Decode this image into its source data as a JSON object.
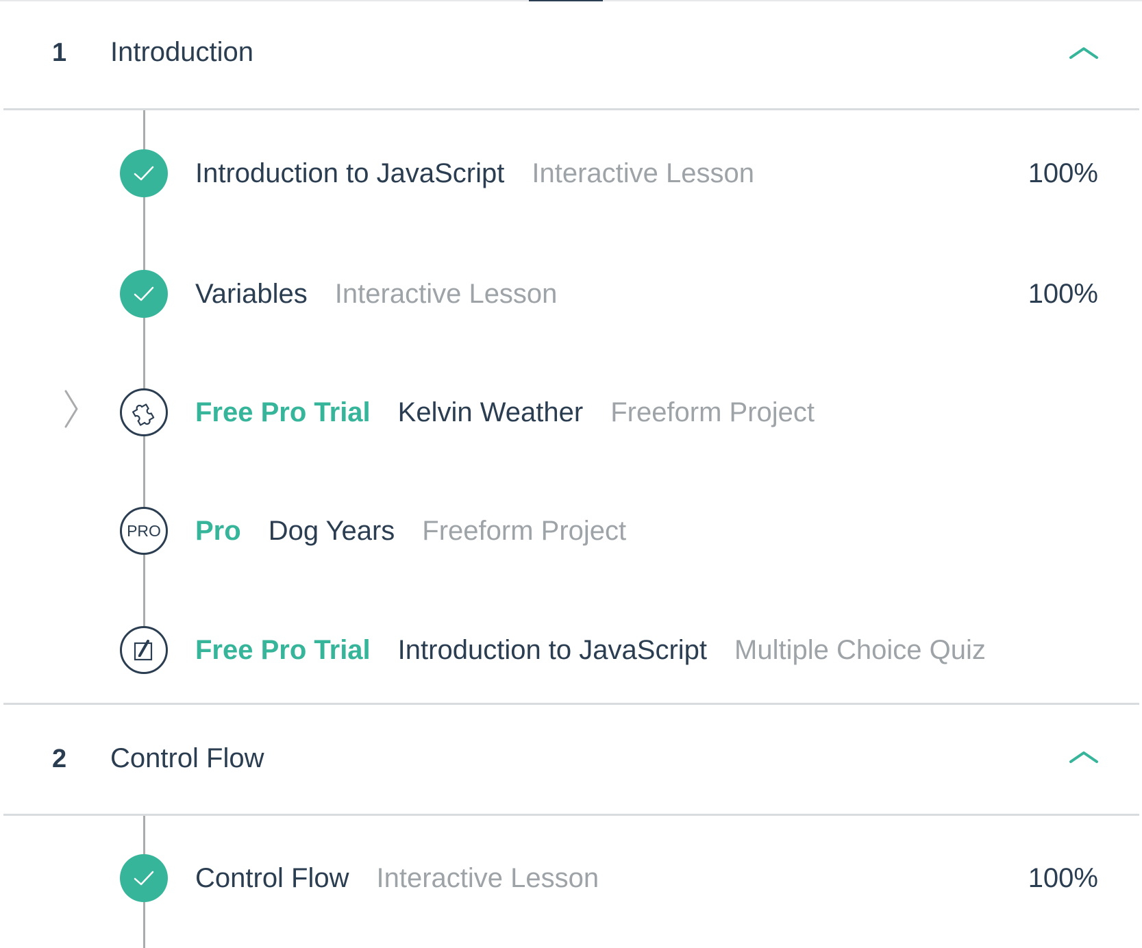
{
  "colors": {
    "accent": "#36b59b",
    "text_dark": "#2b3d50",
    "text_muted": "#9ea3a8",
    "rule": "#d9dcde",
    "timeline": "#a9abad"
  },
  "sections": [
    {
      "number": "1",
      "title": "Introduction",
      "expanded": true,
      "items": [
        {
          "status": "complete",
          "icon": "check-icon",
          "badge": "",
          "title": "Introduction to JavaScript",
          "type": "Interactive Lesson",
          "progress": "100%"
        },
        {
          "status": "complete",
          "icon": "check-icon",
          "badge": "",
          "title": "Variables",
          "type": "Interactive Lesson",
          "progress": "100%"
        },
        {
          "status": "current",
          "icon": "puzzle-icon",
          "badge": "Free Pro Trial",
          "title": "Kelvin Weather",
          "type": "Freeform Project",
          "progress": ""
        },
        {
          "status": "locked",
          "icon": "pro-icon",
          "icon_text": "PRO",
          "badge": "Pro",
          "title": "Dog Years",
          "type": "Freeform Project",
          "progress": ""
        },
        {
          "status": "locked",
          "icon": "quiz-icon",
          "badge": "Free Pro Trial",
          "title": "Introduction to JavaScript",
          "type": "Multiple Choice Quiz",
          "progress": ""
        }
      ]
    },
    {
      "number": "2",
      "title": "Control Flow",
      "expanded": true,
      "items": [
        {
          "status": "complete",
          "icon": "check-icon",
          "badge": "",
          "title": "Control Flow",
          "type": "Interactive Lesson",
          "progress": "100%"
        }
      ]
    }
  ]
}
